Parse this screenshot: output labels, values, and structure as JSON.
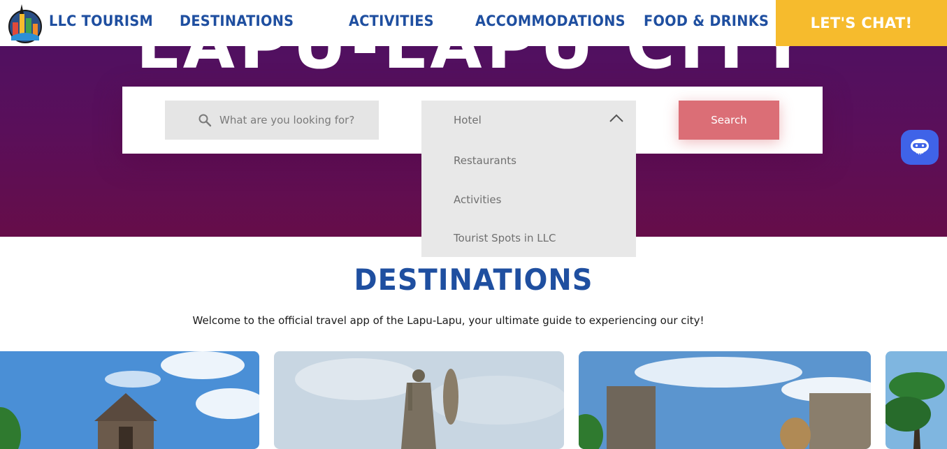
{
  "nav": {
    "brand": "LLC TOURISM",
    "links": [
      "DESTINATIONS",
      "ACTIVITIES",
      "ACCOMMODATIONS",
      "FOOD & DRINKS"
    ],
    "chat_label": "LET'S CHAT!"
  },
  "hero": {
    "title": "LAPU-LAPU CITY"
  },
  "search": {
    "placeholder": "What are you looking for?",
    "category_selected": "Hotel",
    "category_options": [
      "Restaurants",
      "Activities",
      "Tourist Spots in LLC"
    ],
    "button_label": "Search"
  },
  "destinations": {
    "title": "DESTINATIONS",
    "subtitle": "Welcome to the official travel app of the Lapu-Lapu, your ultimate guide to experiencing our city!"
  },
  "colors": {
    "brand_blue": "#1f4fa0",
    "chat_yellow": "#f6bb2d",
    "hero_purple": "#5a0f5a",
    "search_button": "#db6e76",
    "chatbot_blue": "#3f63e8"
  },
  "icons": [
    "city-logo-icon",
    "search-icon",
    "chevron-up-icon",
    "chatbot-icon"
  ]
}
